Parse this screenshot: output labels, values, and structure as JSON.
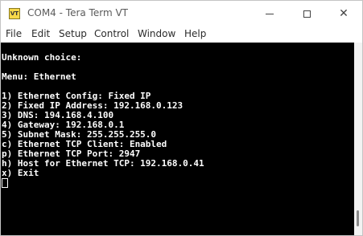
{
  "window": {
    "title": "COM4 - Tera Term VT",
    "icon_label": "VT"
  },
  "menu": [
    "File",
    "Edit",
    "Setup",
    "Control",
    "Window",
    "Help"
  ],
  "terminal": {
    "lines": [
      "",
      "Unknown choice:",
      "",
      "Menu: Ethernet",
      "",
      "1) Ethernet Config: Fixed IP",
      "2) Fixed IP Address: 192.168.0.123",
      "3) DNS: 194.168.4.100",
      "4) Gateway: 192.168.0.1",
      "5) Subnet Mask: 255.255.255.0",
      "c) Ethernet TCP Client: Enabled",
      "p) Ethernet TCP Port: 2947",
      "h) Host for Ethernet TCP: 192.168.0.41",
      "x) Exit"
    ]
  },
  "icons": {
    "minimize": "minimize-icon",
    "maximize": "maximize-icon",
    "close": "close-icon"
  },
  "colors": {
    "terminal_bg": "#000000",
    "terminal_fg": "#ffffff"
  }
}
